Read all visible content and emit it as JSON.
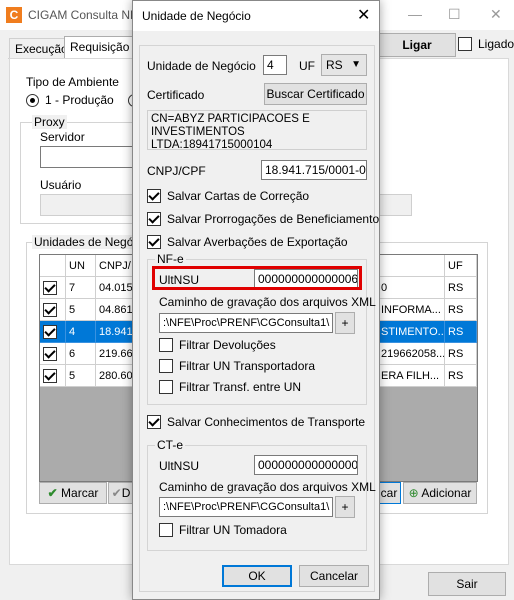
{
  "background": {
    "title": "CIGAM Consulta NFe",
    "logo": "C",
    "tabs": [
      "Execução",
      "Requisição"
    ],
    "ligar_label": "Ligar",
    "ligado_label": "Ligado",
    "tipo_ambiente_label": "Tipo de Ambiente",
    "ambiente_option": "1 - Produção",
    "proxy_label": "Proxy",
    "servidor_label": "Servidor",
    "usuario_label": "Usuário",
    "unidades_label": "Unidades de Negócio",
    "grid": {
      "headers": [
        "UN",
        "CNPJ/",
        "UF"
      ],
      "rows": [
        {
          "checked": true,
          "un": "7",
          "cnpj": "04.015.",
          "right": "0",
          "uf": "RS",
          "selected": false
        },
        {
          "checked": true,
          "un": "5",
          "cnpj": "04.861.4",
          "right": "INFORMA...",
          "uf": "RS",
          "selected": false
        },
        {
          "checked": true,
          "un": "4",
          "cnpj": "18.941.",
          "right": "STIMENTO...",
          "uf": "RS",
          "selected": true
        },
        {
          "checked": true,
          "un": "6",
          "cnpj": "219.662",
          "right": "219662058...",
          "uf": "RS",
          "selected": false
        },
        {
          "checked": true,
          "un": "5",
          "cnpj": "280.601",
          "right": "ERA FILH...",
          "uf": "RS",
          "selected": false
        }
      ]
    },
    "marcar_label": "Marcar",
    "desmarcar_partial": "D",
    "cancelar_partial": "car",
    "adicionar_label": "Adicionar",
    "sair_label": "Sair"
  },
  "dialog": {
    "title": "Unidade de Negócio",
    "unidade_label": "Unidade de Negócio",
    "unidade_value": "4",
    "uf_label": "UF",
    "uf_value": "RS",
    "certificado_label": "Certificado",
    "buscar_certificado": "Buscar Certificado",
    "certificado_text_1": "CN=ABYZ PARTICIPACOES E",
    "certificado_text_2": "INVESTIMENTOS LTDA:18941715000104",
    "cnpj_label": "CNPJ/CPF",
    "cnpj_value": "18.941.715/0001-04",
    "chk_cartas": "Salvar Cartas de Correção",
    "chk_prorrogacoes": "Salvar Prorrogações de Beneficiamento",
    "chk_averbacoes": "Salvar Averbações de Exportação",
    "nfe_group": "NF-e",
    "nfe_ultnsu_label": "UltNSU",
    "nfe_ultnsu_value": "000000000000006",
    "nfe_caminho_label": "Caminho de gravação dos arquivos XML",
    "nfe_caminho_value": ":\\NFE\\Proc\\PRENF\\CGConsulta1\\",
    "plus": "+",
    "chk_filtrar_devolucoes": "Filtrar Devoluções",
    "chk_filtrar_un_transportadora": "Filtrar UN Transportadora",
    "chk_filtrar_transf": "Filtrar Transf. entre UN",
    "chk_conhecimentos": "Salvar Conhecimentos de Transporte",
    "cte_group": "CT-e",
    "cte_ultnsu_label": "UltNSU",
    "cte_ultnsu_value": "000000000000000",
    "cte_caminho_label": "Caminho de gravação dos arquivos XML",
    "cte_caminho_value": ":\\NFE\\Proc\\PRENF\\CGConsulta1\\",
    "chk_filtrar_un_tomadora": "Filtrar UN Tomadora",
    "ok_label": "OK",
    "cancelar_label": "Cancelar"
  }
}
